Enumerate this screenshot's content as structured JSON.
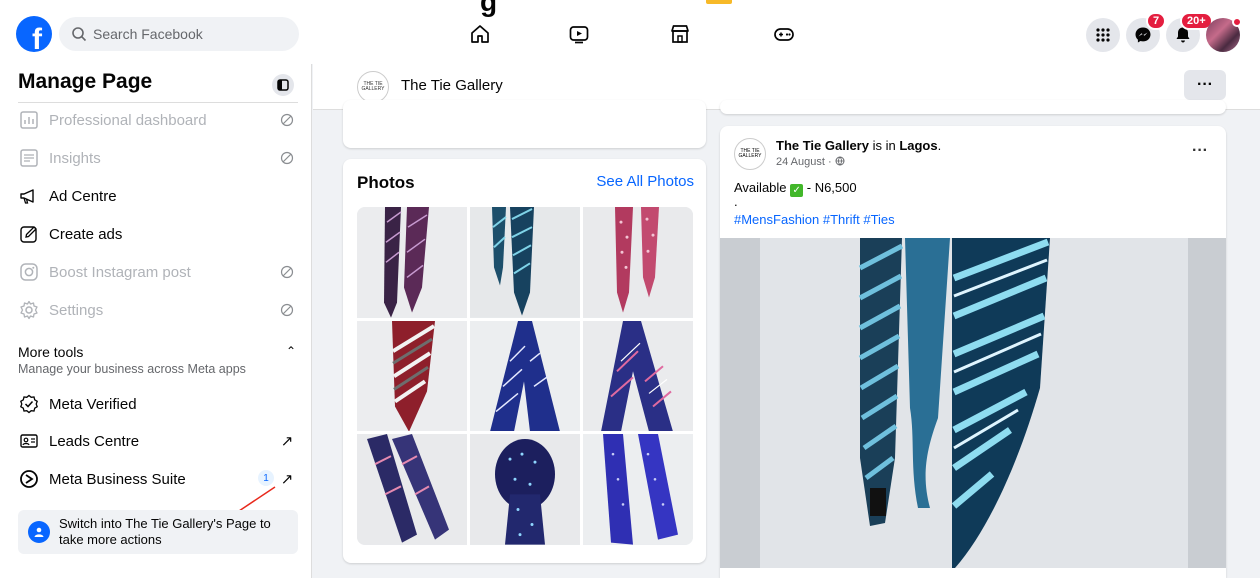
{
  "topbar": {
    "logo_letter": "f",
    "search_placeholder": "Search Facebook",
    "cut_off_title": "g",
    "messenger_badge": "7",
    "notifications_badge": "20+"
  },
  "sidebar": {
    "title": "Manage Page",
    "items": [
      {
        "label": "Professional dashboard",
        "icon": "dashboard-icon",
        "disabled": true
      },
      {
        "label": "Insights",
        "icon": "insights-icon",
        "disabled": true
      },
      {
        "label": "Ad Centre",
        "icon": "megaphone-icon",
        "disabled": false
      },
      {
        "label": "Create ads",
        "icon": "pencil-icon",
        "disabled": false
      },
      {
        "label": "Boost Instagram post",
        "icon": "instagram-icon",
        "disabled": true
      },
      {
        "label": "Settings",
        "icon": "gear-icon",
        "disabled": true
      }
    ],
    "more_tools": {
      "title": "More tools",
      "subtitle": "Manage your business across Meta apps",
      "items": [
        {
          "label": "Meta Verified",
          "icon": "verified-icon"
        },
        {
          "label": "Leads Centre",
          "icon": "leads-icon"
        },
        {
          "label": "Meta Business Suite",
          "icon": "business-suite-icon",
          "badge": "1"
        }
      ]
    },
    "switch_text": "Switch into The Tie Gallery's Page to take more actions"
  },
  "page_header": {
    "logo_text": "THE TIE GALLERY",
    "name": "The Tie Gallery",
    "more_label": "···"
  },
  "photos": {
    "title": "Photos",
    "see_all": "See All Photos"
  },
  "post": {
    "author": "The Tie Gallery",
    "connector": " is in ",
    "location": "Lagos",
    "date": "24 August · ",
    "text_before": "Available ",
    "check_mark": "✓",
    "text_after": " - N6,500",
    "dot_line": ".",
    "hashtags": "#MensFashion #Thrift #Ties",
    "more_label": "···"
  },
  "colors": {
    "brand": "#0866ff",
    "badge": "#e41e3f",
    "active_tab": "#f7b928"
  }
}
